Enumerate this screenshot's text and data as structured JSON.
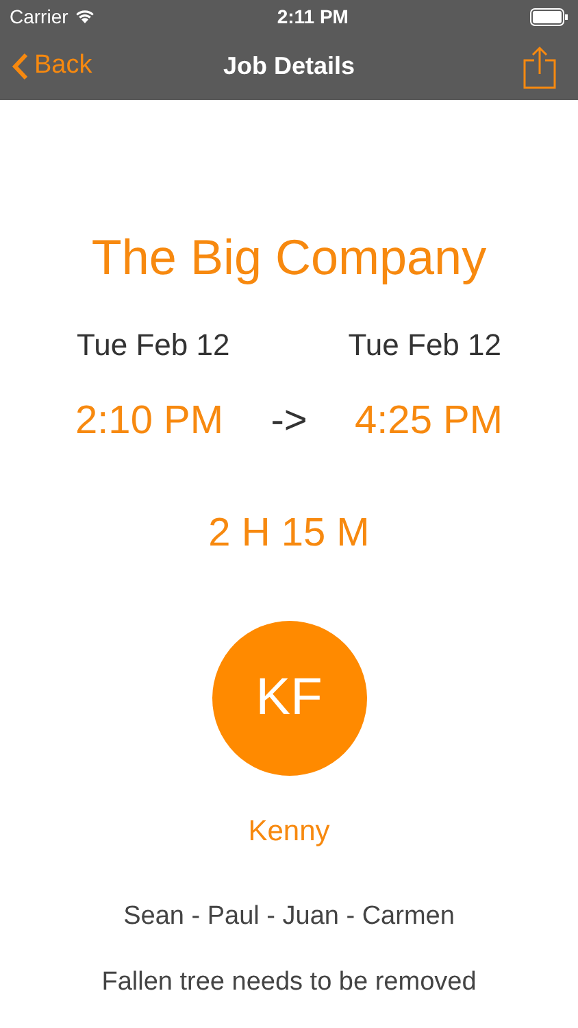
{
  "status_bar": {
    "carrier": "Carrier",
    "time": "2:11 PM"
  },
  "nav": {
    "back": "Back",
    "title": "Job Details"
  },
  "job": {
    "company": "The Big Company",
    "start_date": "Tue Feb 12",
    "end_date": "Tue Feb 12",
    "start_time": "2:10 PM",
    "arrow": "->",
    "end_time": "4:25 PM",
    "duration": "2 H 15 M",
    "initials": "KF",
    "lead": "Kenny",
    "crew": "Sean - Paul - Juan - Carmen",
    "description": "Fallen tree needs to be removed"
  }
}
